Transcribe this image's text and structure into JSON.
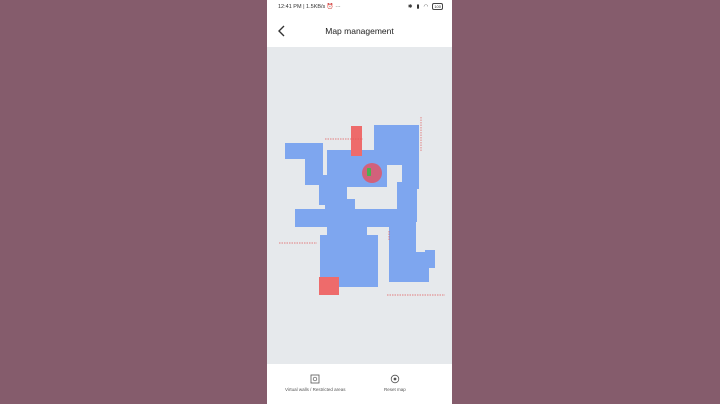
{
  "status_bar": {
    "time": "12:41 PM",
    "network_speed": "1.5KB/s",
    "battery": "100"
  },
  "header": {
    "title": "Map management"
  },
  "colors": {
    "floor": "#7ea6ef",
    "restricted": "#ee6b6b",
    "virtual_wall": "#e25a5a",
    "robot": "#4caf50",
    "background": "#855c6c",
    "map_background": "#e6e9ec"
  },
  "icons": {
    "back": "chevron-left-icon",
    "virtual_walls": "virtual-wall-icon",
    "reset": "reset-map-icon"
  },
  "bottom_actions": {
    "virtual_walls_label": "Virtual walls / Restricted areas",
    "reset_label": "Reset map"
  }
}
